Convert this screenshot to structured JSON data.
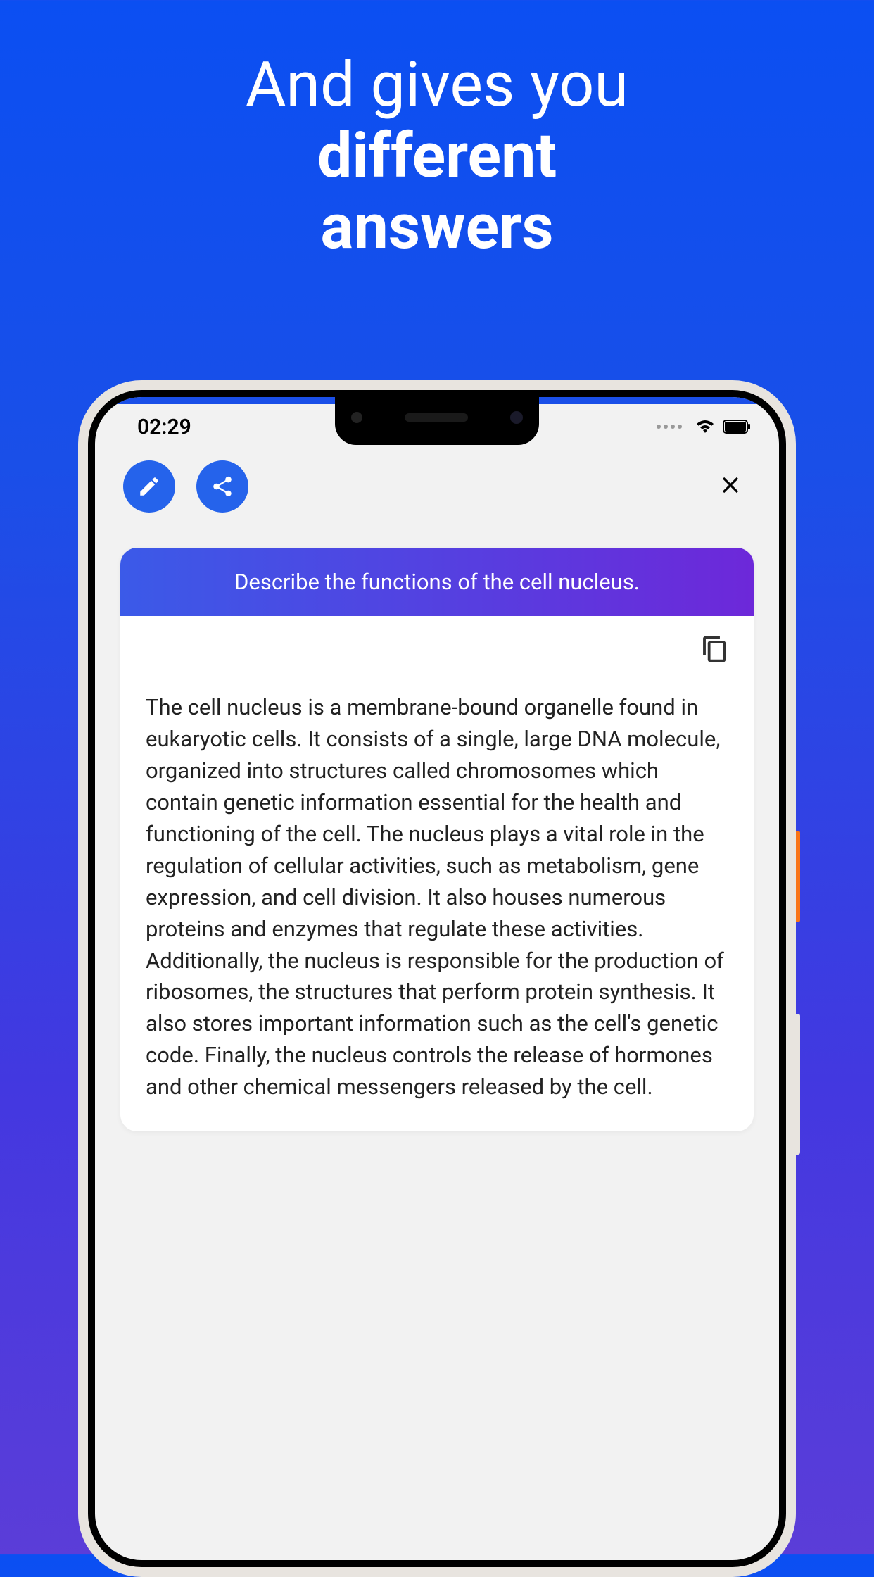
{
  "promo": {
    "line1": "And gives you",
    "line2": "different",
    "line3": "answers"
  },
  "status_bar": {
    "time": "02:29"
  },
  "card": {
    "prompt": "Describe the functions of the cell nucleus.",
    "answer": "The cell nucleus is a membrane-bound organelle found in eukaryotic cells. It consists of a single, large DNA molecule, organized into structures called chromosomes which contain genetic information essential for the health and functioning of the cell. The nucleus plays a vital role in the regulation of cellular activities, such as metabolism, gene expression, and cell division. It also houses numerous proteins and enzymes that regulate these activities. Additionally, the nucleus is responsible for the production of ribosomes, the structures that perform protein synthesis. It also stores important information such as the cell's genetic code. Finally, the nucleus controls the release of hormones and other chemical messengers released by the cell."
  }
}
